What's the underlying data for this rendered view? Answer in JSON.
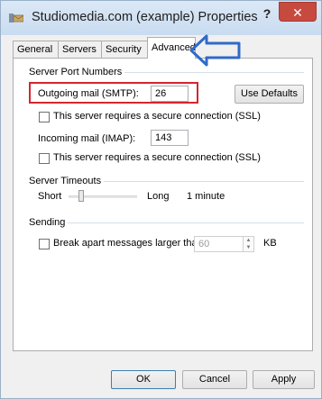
{
  "window": {
    "title": "Studiomedia.com (example) Properties",
    "help_glyph": "?",
    "close_glyph": "✕"
  },
  "tabs": [
    {
      "label": "General",
      "active": false
    },
    {
      "label": "Servers",
      "active": false
    },
    {
      "label": "Security",
      "active": false
    },
    {
      "label": "Advanced",
      "active": true
    }
  ],
  "server_ports": {
    "group_label": "Server Port Numbers",
    "outgoing_label": "Outgoing mail (SMTP):",
    "outgoing_value": "26",
    "use_defaults_label": "Use Defaults",
    "outgoing_ssl_label": "This server requires a secure connection (SSL)",
    "outgoing_ssl_checked": false,
    "incoming_label": "Incoming mail (IMAP):",
    "incoming_value": "143",
    "incoming_ssl_label": "This server requires a secure connection (SSL)",
    "incoming_ssl_checked": false
  },
  "timeouts": {
    "group_label": "Server Timeouts",
    "short_label": "Short",
    "long_label": "Long",
    "value_label": "1 minute"
  },
  "sending": {
    "group_label": "Sending",
    "break_apart_label": "Break apart messages larger than",
    "break_apart_checked": false,
    "size_value": "60",
    "unit_label": "KB"
  },
  "footer": {
    "ok_label": "OK",
    "cancel_label": "Cancel",
    "apply_label": "Apply"
  },
  "annotations": {
    "highlight_color": "#d4262c",
    "arrow_color": "#2f6bc9"
  }
}
